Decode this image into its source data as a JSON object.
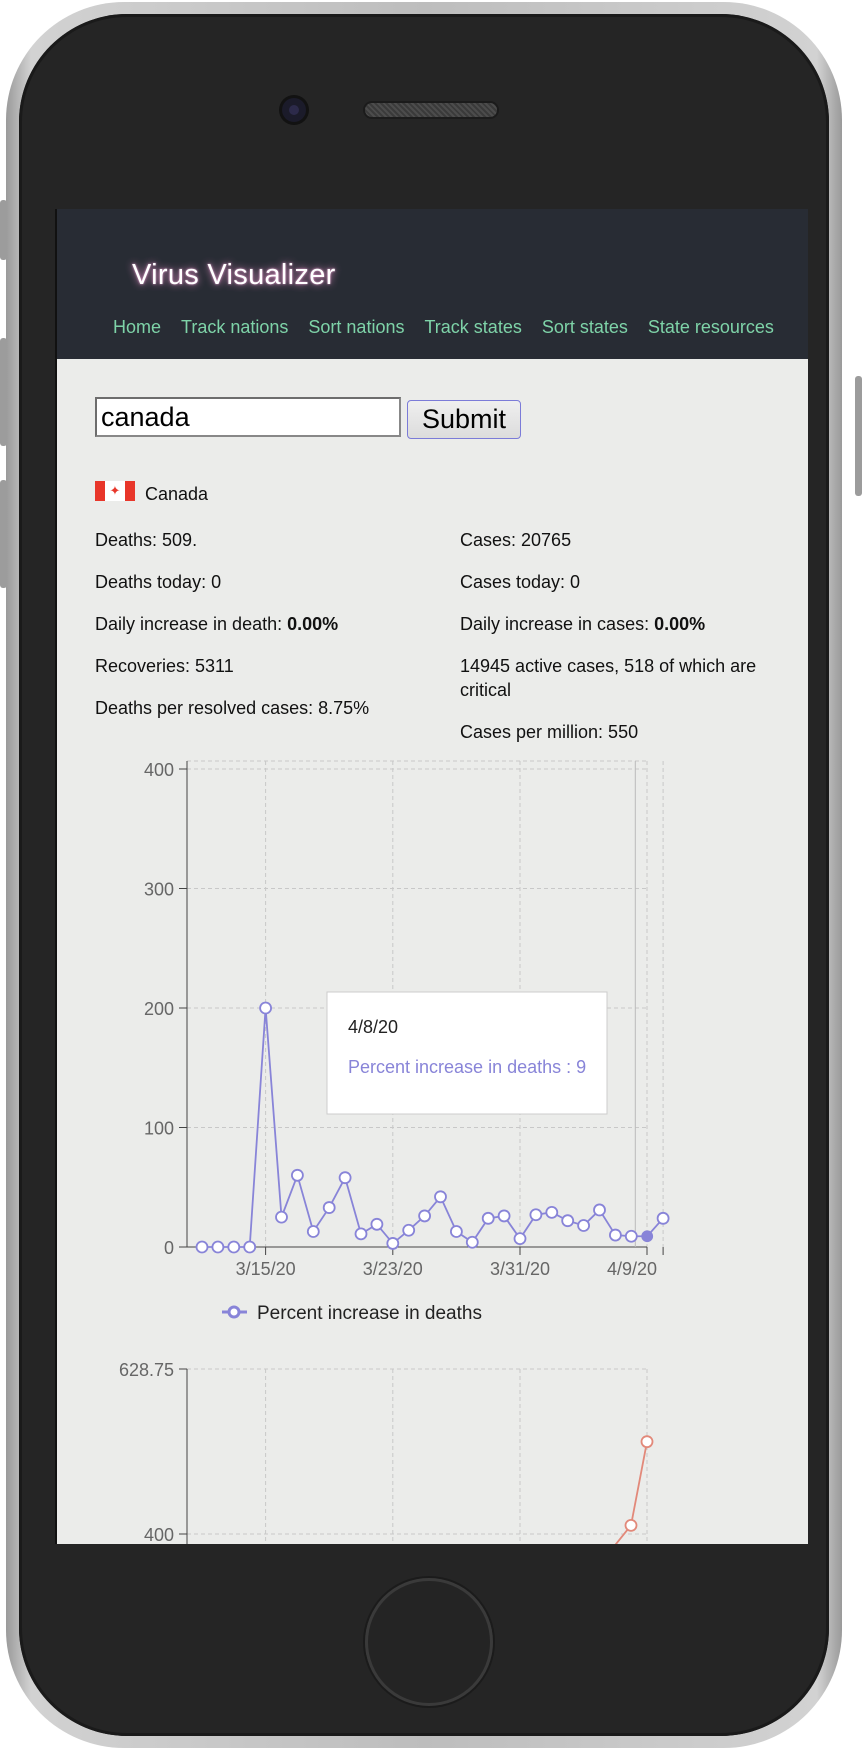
{
  "app": {
    "title": "Virus Visualizer",
    "nav": [
      "Home",
      "Track nations",
      "Sort nations",
      "Track states",
      "Sort states",
      "State resources"
    ]
  },
  "search": {
    "value": "canada",
    "submit_label": "Submit"
  },
  "country": {
    "name": "Canada",
    "flag": "canada-flag-icon"
  },
  "stats": {
    "deaths": "Deaths: 509.",
    "deaths_today": "Deaths today: 0",
    "daily_increase_death_label": "Daily increase in death: ",
    "daily_increase_death_value": "0.00%",
    "recoveries": "Recoveries: 5311",
    "deaths_per_resolved": "Deaths per resolved cases: 8.75%",
    "cases": "Cases: 20765",
    "cases_today": "Cases today: 0",
    "daily_increase_cases_label": "Daily increase in cases: ",
    "daily_increase_cases_value": "0.00%",
    "active_cases": "14945 active cases, 518 of which are critical",
    "cases_per_million": "Cases per million: 550"
  },
  "colors": {
    "header_bg": "#282c34",
    "nav_link": "#7ed3a8",
    "series_deaths": "#8884d8",
    "series_cases": "#e2897a"
  },
  "chart_data": [
    {
      "type": "line",
      "x_ticks": [
        "3/15/20",
        "3/23/20",
        "3/31/20",
        "4/9/20"
      ],
      "y_ticks": [
        0,
        100,
        200,
        300,
        400
      ],
      "ylim": [
        0,
        400
      ],
      "grid": true,
      "legend_position": "bottom",
      "series": [
        {
          "name": "Percent increase in deaths",
          "x": [
            "3/11/20",
            "3/12/20",
            "3/13/20",
            "3/14/20",
            "3/15/20",
            "3/16/20",
            "3/17/20",
            "3/18/20",
            "3/19/20",
            "3/20/20",
            "3/21/20",
            "3/22/20",
            "3/23/20",
            "3/24/20",
            "3/25/20",
            "3/26/20",
            "3/27/20",
            "3/28/20",
            "3/29/20",
            "3/30/20",
            "3/31/20",
            "4/1/20",
            "4/2/20",
            "4/3/20",
            "4/4/20",
            "4/5/20",
            "4/6/20",
            "4/7/20",
            "4/8/20",
            "4/9/20"
          ],
          "values": [
            0,
            0,
            0,
            0,
            200,
            25,
            60,
            13,
            33,
            58,
            11,
            19,
            3,
            14,
            26,
            42,
            13,
            4,
            24,
            26,
            7,
            27,
            29,
            22,
            18,
            31,
            10,
            9,
            9,
            24
          ]
        }
      ],
      "tooltip": {
        "date": "4/8/20",
        "label": "Percent increase in deaths : 9"
      }
    },
    {
      "type": "line",
      "y_ticks": [
        400,
        628.75
      ],
      "grid": true,
      "series": [
        {
          "x": [
            "4/8/20",
            "4/9/20"
          ],
          "values": [
            412,
            528
          ]
        }
      ]
    }
  ]
}
